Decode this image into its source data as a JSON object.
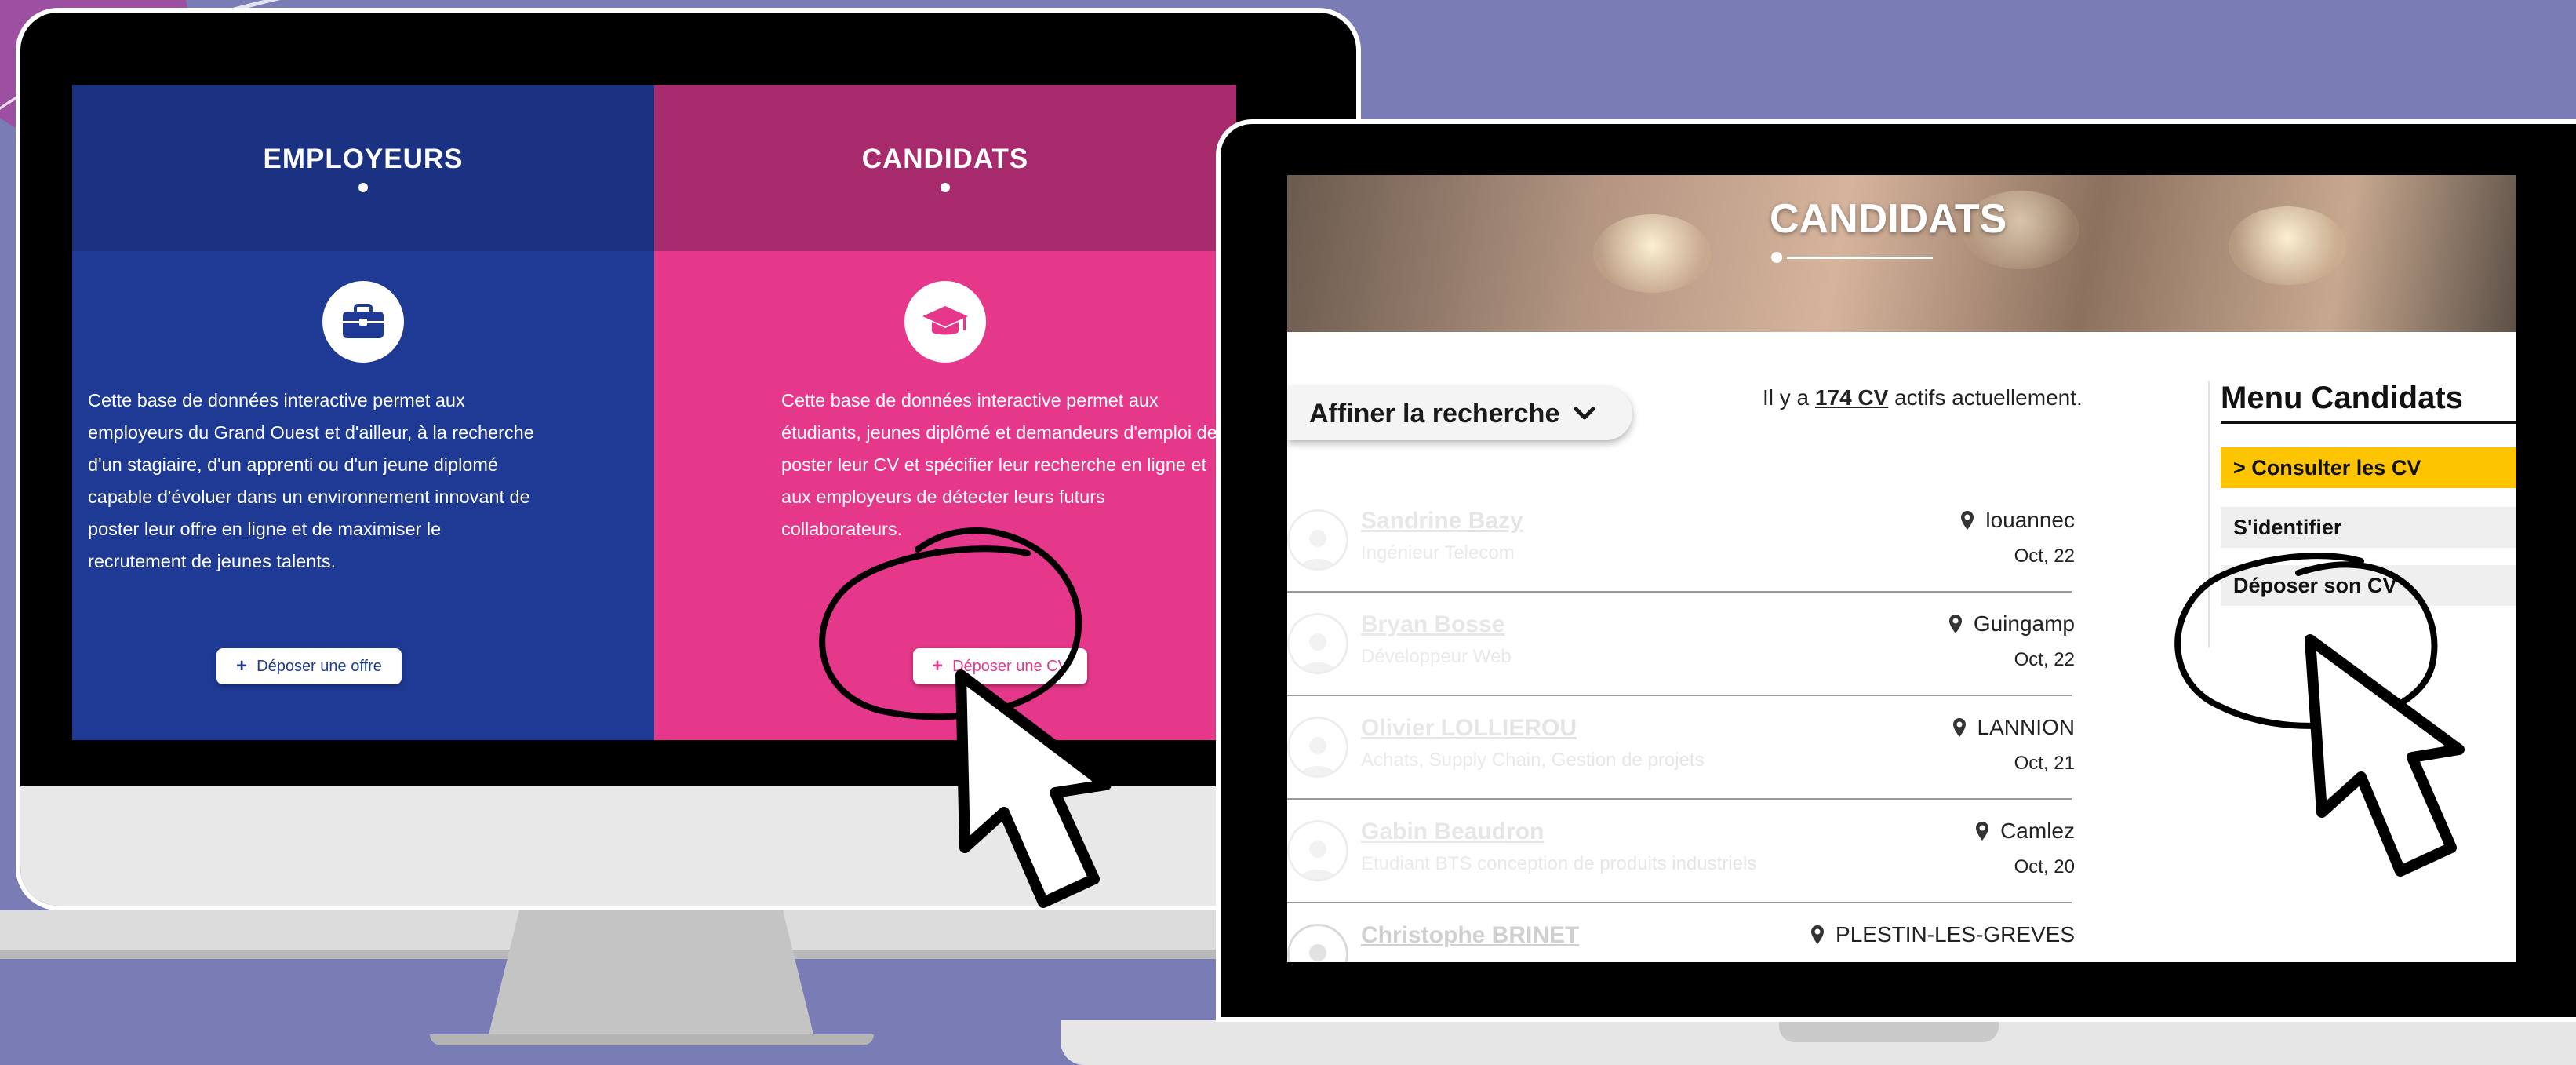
{
  "desktop": {
    "employeurs": {
      "title": "EMPLOYEURS",
      "icon": "briefcase-icon",
      "text": "Cette base de données interactive permet aux employeurs du Grand Ouest et d'ailleur, à la recherche d'un stagiaire, d'un apprenti ou d'un jeune diplomé capable d'évoluer dans un environnement innovant de poster leur offre en ligne et de maximiser le recrutement de jeunes talents.",
      "button": "Déposer une offre",
      "color": "#1f3a94"
    },
    "candidats": {
      "title": "CANDIDATS",
      "icon": "graduation-cap-icon",
      "text": "Cette base de données interactive permet aux étudiants, jeunes diplômé et demandeurs d'emploi de poster leur CV et spécifier leur recherche en ligne et aux employeurs de détecter leurs futurs collaborateurs.",
      "button": "Déposer une CV",
      "color": "#e5388a"
    }
  },
  "laptop": {
    "hero_title": "CANDIDATS",
    "refine_label": "Affiner la recherche",
    "count": {
      "prefix": "Il y a ",
      "value": "174 CV",
      "suffix": " actifs actuellement."
    },
    "candidates": [
      {
        "name": "Sandrine Bazy",
        "job": "Ingénieur Telecom",
        "location": "louannec",
        "date": "Oct, 22"
      },
      {
        "name": "Bryan Bosse",
        "job": "Développeur Web",
        "location": "Guingamp",
        "date": "Oct, 22"
      },
      {
        "name": "Olivier LOLLIEROU",
        "job": "Achats, Supply Chain, Gestion de projets",
        "location": "LANNION",
        "date": "Oct, 21"
      },
      {
        "name": "Gabin Beaudron",
        "job": "Etudiant BTS conception de produits industriels",
        "location": "Camlez",
        "date": "Oct, 20"
      },
      {
        "name": "Christophe BRINET",
        "job": "",
        "location": "PLESTIN-LES-GREVES",
        "date": ""
      }
    ],
    "menu": {
      "title": "Menu Candidats",
      "items": [
        "> Consulter les CV",
        "S'identifier",
        "Déposer son CV"
      ],
      "active_color": "#fdc400"
    }
  }
}
